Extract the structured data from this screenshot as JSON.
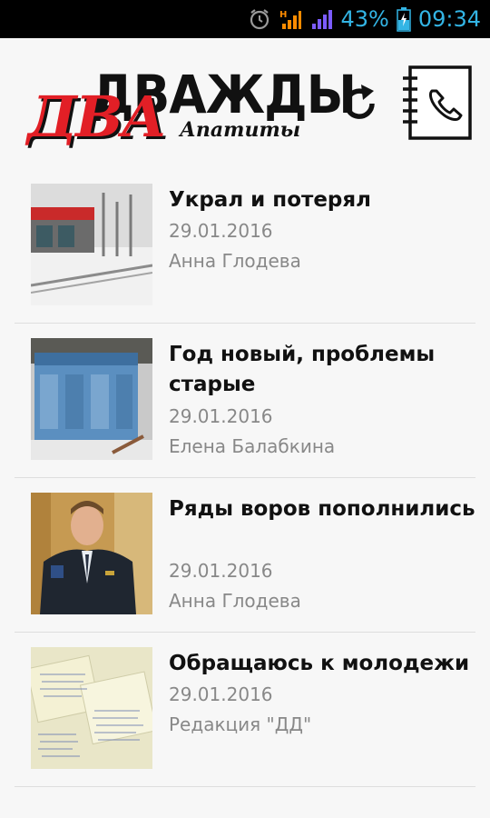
{
  "status_bar": {
    "battery": "43%",
    "time": "09:34"
  },
  "header": {
    "logo_top": "ДВАЖДЫ",
    "logo_red": "ДВА",
    "logo_sub": "Апатиты"
  },
  "articles": [
    {
      "title": "Украл и потерял",
      "date": "29.01.2016",
      "author": "Анна Глодева"
    },
    {
      "title": "Год новый, проблемы старые",
      "date": "29.01.2016",
      "author": "Елена Балабкина"
    },
    {
      "title": "Ряды воров пополнились",
      "date": "29.01.2016",
      "author": "Анна Глодева"
    },
    {
      "title": "Обращаюсь к молодежи",
      "date": "29.01.2016",
      "author": "Редакция \"ДД\""
    }
  ],
  "icons": {
    "alarm": "alarm-clock-icon",
    "signal": "cell-signal-icon",
    "battery": "battery-charging-icon",
    "refresh": "refresh-icon",
    "contacts": "phone-book-icon"
  },
  "colors": {
    "status_accent": "#33b5e5",
    "logo_red": "#e21f26"
  }
}
